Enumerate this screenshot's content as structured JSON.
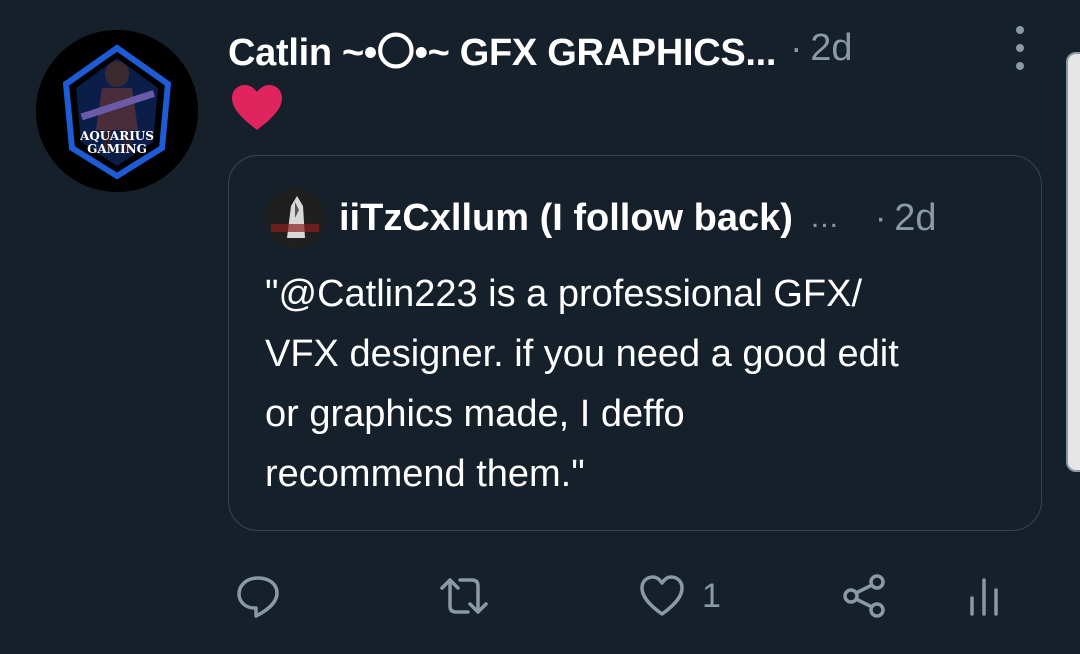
{
  "tweet": {
    "author": "Catlin ~•〇•~ GFX GRAPHICS...",
    "separator": "·",
    "time": "2d",
    "avatar_text": [
      "AQUARIUS",
      "GAMING"
    ],
    "content_emoji": "heart"
  },
  "quoted": {
    "author": "iiTzCxllum (I follow back)",
    "ellipsis": "...",
    "separator": "·",
    "time": "2d",
    "text": "\"@Catlin223 is a professional GFX/\nVFX designer. if you need a good edit\nor graphics made, I deffo\nrecommend them.\""
  },
  "actions": {
    "reply_icon": "reply-icon",
    "retweet_icon": "retweet-icon",
    "like_icon": "heart-outline-icon",
    "like_count": "1",
    "share_icon": "share-icon",
    "analytics_icon": "analytics-icon"
  },
  "colors": {
    "background": "#15202b",
    "text": "#ffffff",
    "muted": "#8b98a5",
    "border": "#38444d",
    "heart": "#e0245e",
    "avatar_blue": "#1e5bd6"
  }
}
